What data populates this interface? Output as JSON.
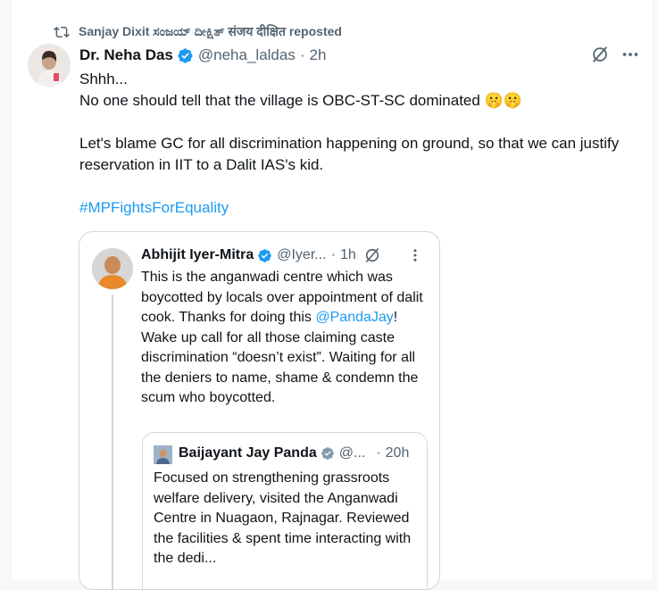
{
  "repost": {
    "text": "Sanjay Dixit ಸಂಜಯ್ ದೀಕ್ಷಿತ್ संजय दीक्षित reposted"
  },
  "post": {
    "author_name": "Dr. Neha Das",
    "handle": "@neha_laldas",
    "separator": "·",
    "time": "2h",
    "lines": [
      "Shhh...",
      "No one should tell that the village is OBC-ST-SC dominated 🤫🤫",
      "",
      "Let's blame GC for all discrimination happening on ground, so that we can justify reservation in IIT to a Dalit IAS's kid.",
      ""
    ],
    "hashtag": "#MPFightsForEquality"
  },
  "quote": {
    "author_name": "Abhijit Iyer-Mitra",
    "handle": "@Iyer...",
    "separator": "·",
    "time": "1h",
    "text_before_mention": "This is the anganwadi centre which was boycotted by locals over  appointment of dalit cook. Thanks for doing this ",
    "mention": "@PandaJay",
    "text_after_mention": "! Wake up call for all those claiming caste discrimination “doesn’t exist”. Waiting for all the deniers to name, shame & condemn the scum who boycotted."
  },
  "inner_quote": {
    "author_name": "Baijayant Jay Panda",
    "handle": "@...",
    "separator": "·",
    "time": "20h",
    "text": "Focused on strengthening grassroots welfare delivery, visited the Anganwadi Centre in Nuagaon, Rajnagar. Reviewed the facilities & spent time interacting with the dedi..."
  },
  "icons": {
    "repost": "repost-icon",
    "verified": "verified-badge-icon",
    "grok": "grok-icon",
    "more": "more-icon"
  },
  "colors": {
    "link": "#1d9bf0",
    "secondary_text": "#536471",
    "verified": "#1d9bf0"
  }
}
